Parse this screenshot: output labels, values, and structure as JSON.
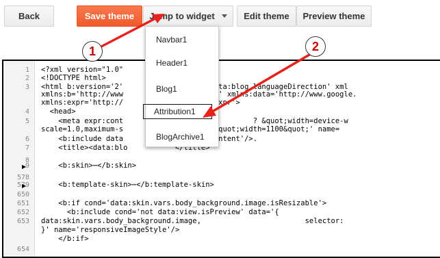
{
  "toolbar": {
    "back_label": "Back",
    "save_label": "Save theme",
    "jump_label": "Jump to widget",
    "edit_label": "Edit theme",
    "preview_label": "Preview theme"
  },
  "dropdown": {
    "items": [
      "Navbar1",
      "Header1",
      "Blog1",
      "Attribution1",
      "BlogArchive1"
    ],
    "active": "Attribution1"
  },
  "annotations": {
    "badge1": "1",
    "badge2": "2"
  },
  "colors": {
    "save": "#f05e2f",
    "arrow": "#e8211b",
    "badge_text": "#c60000"
  },
  "editor": {
    "line_numbers": [
      "1",
      "2",
      "3",
      "",
      "",
      "4",
      "5",
      "",
      "6",
      "7",
      "8",
      "9",
      "578",
      "579",
      "650",
      "651",
      "652",
      "653",
      "",
      "",
      "654"
    ],
    "fold_markers": [
      "9",
      "579"
    ],
    "lines": [
      "<?xml version=\"1.0\"              F-8\" ?>",
      "<!DOCTYPE html>",
      "<html b:version='2'          expr:dir='data:blog.languageDirection' xml",
      "xmlns:b='http://www             005/gml/b' xmlns:data='http://www.google.",
      "xmlns:expr='http://            2005/gml/expr'>",
      "  <head>",
      "    <meta expr:cont          g.isMobile          ? &quot;width=device-w",
      "scale=1.0,maximum-s                   : &quot;width=1100&quot;' name=",
      "    <b:include data          'all-head-content'/>.",
      "    <title><data:blo           </title>",
      "",
      "    <b:skin>⋯</b:skin>",
      "",
      "    <b:template-skin>⋯</b:template-skin>",
      "",
      "    <b:if cond='data:skin.vars.body_background.image.isResizable'>",
      "      <b:include cond='not data:view.isPreview' data='{",
      "data:skin.vars.body_background.image,                        selector: ",
      "}' name='responsiveImageStyle'/>",
      "    </b:if>",
      ""
    ]
  }
}
